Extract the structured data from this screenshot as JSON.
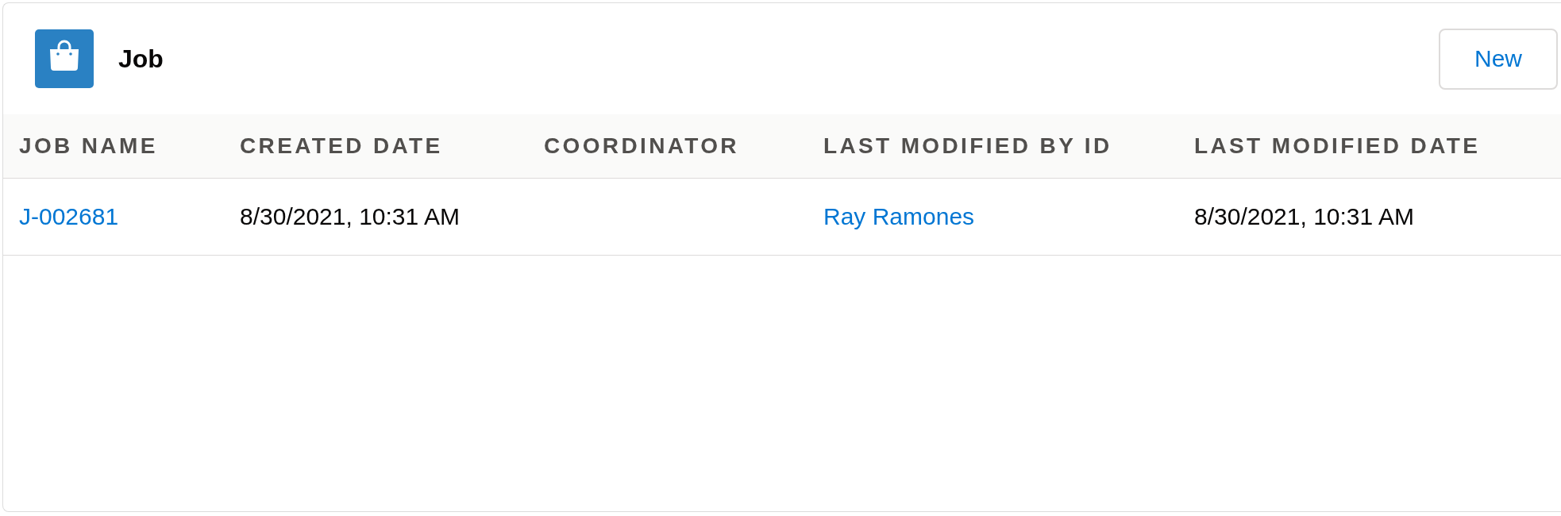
{
  "header": {
    "title": "Job",
    "new_button": "New"
  },
  "table": {
    "columns": [
      "JOB NAME",
      "CREATED DATE",
      "COORDINATOR",
      "LAST MODIFIED BY ID",
      "LAST MODIFIED DATE"
    ],
    "rows": [
      {
        "cells": [
          {
            "kind": "link",
            "text": "J-002681"
          },
          {
            "kind": "text",
            "text": "8/30/2021, 10:31 AM"
          },
          null,
          {
            "kind": "link",
            "text": "Ray Ramones"
          },
          {
            "kind": "text",
            "text": "8/30/2021, 10:31 AM"
          }
        ]
      }
    ]
  }
}
